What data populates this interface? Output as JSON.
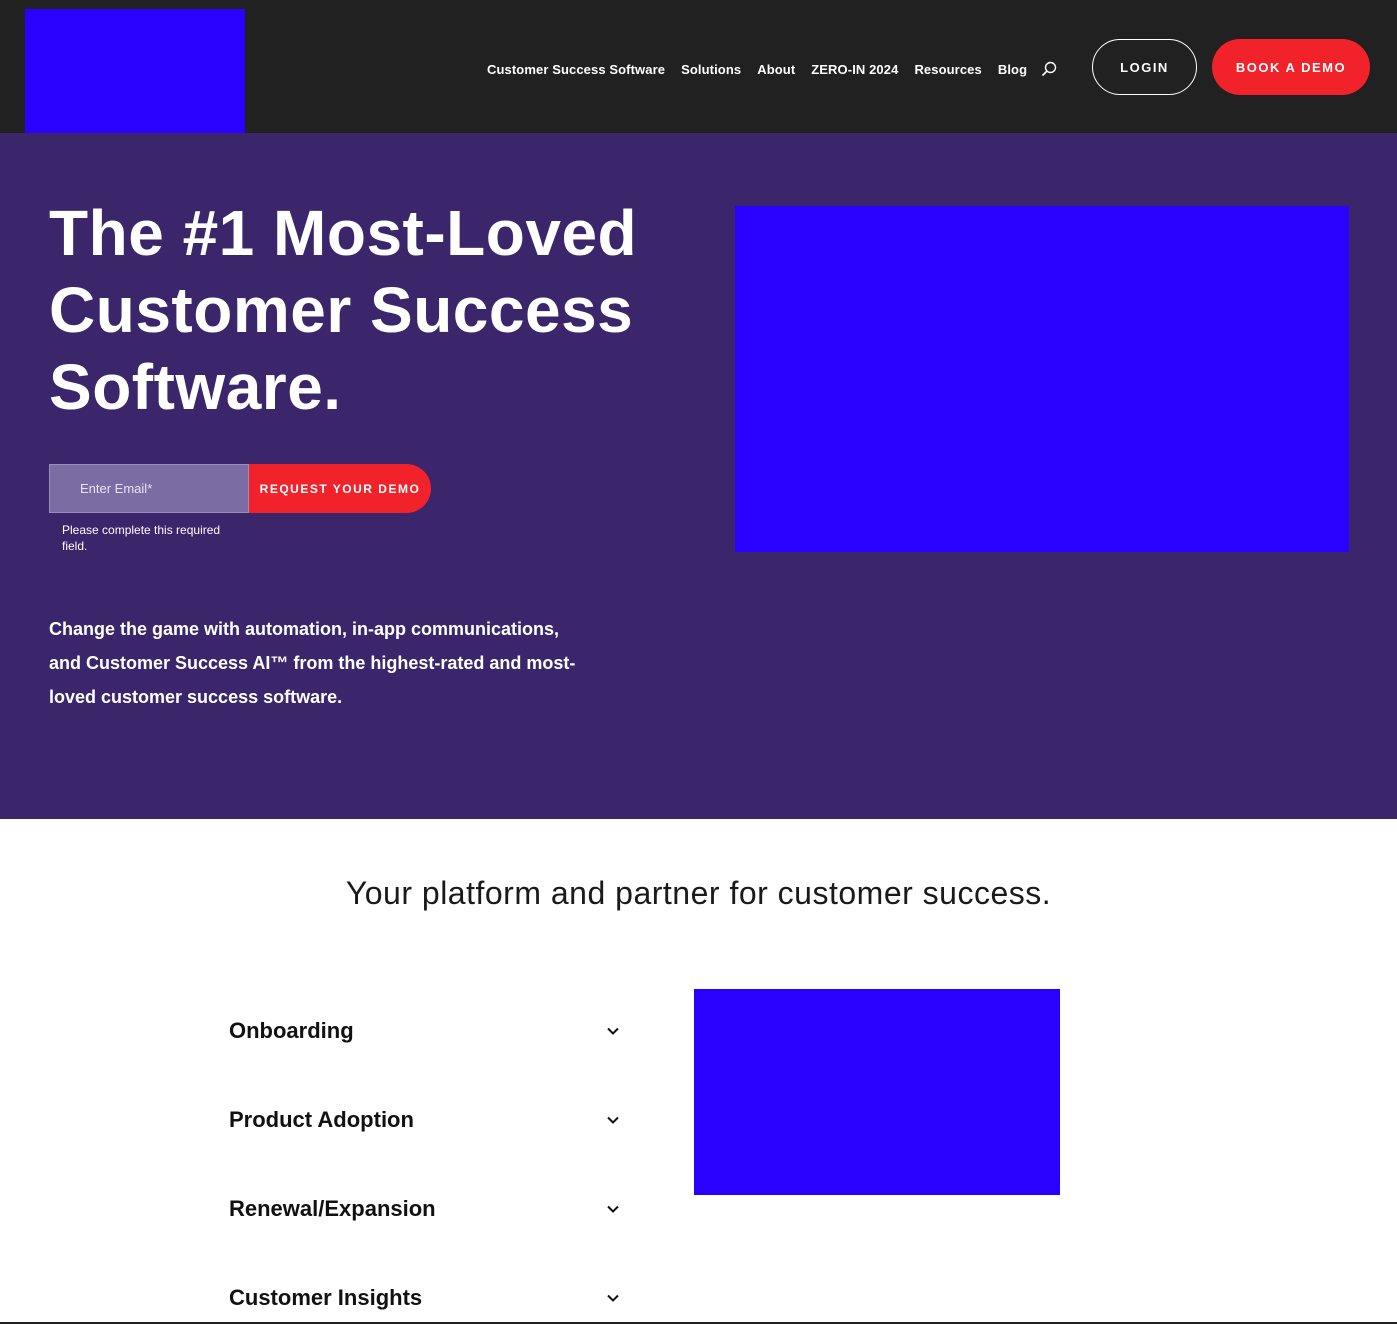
{
  "nav": {
    "items": [
      {
        "label": "Customer Success Software"
      },
      {
        "label": "Solutions"
      },
      {
        "label": "About"
      },
      {
        "label": "ZERO-IN 2024"
      },
      {
        "label": "Resources"
      },
      {
        "label": "Blog"
      }
    ],
    "search_icon": "search-icon",
    "login_label": "LOGIN",
    "demo_label": "BOOK A DEMO"
  },
  "hero": {
    "title": "The #1 Most-Loved Customer Success Software.",
    "email_placeholder": "Enter Email*",
    "request_label": "REQUEST YOUR DEMO",
    "error_text": "Please complete this required field.",
    "description": "Change the game with automation, in-app communications, and Customer Success AI™ from the highest-rated and most-loved customer success software."
  },
  "platform": {
    "title": "Your platform and partner for customer success.",
    "accordion": [
      {
        "label": "Onboarding"
      },
      {
        "label": "Product Adoption"
      },
      {
        "label": "Renewal/Expansion"
      },
      {
        "label": "Customer Insights"
      }
    ]
  },
  "colors": {
    "header_bg": "#212121",
    "hero_bg": "#3b266b",
    "accent_red": "#f2222a",
    "placeholder_blue": "#2a00ff"
  }
}
